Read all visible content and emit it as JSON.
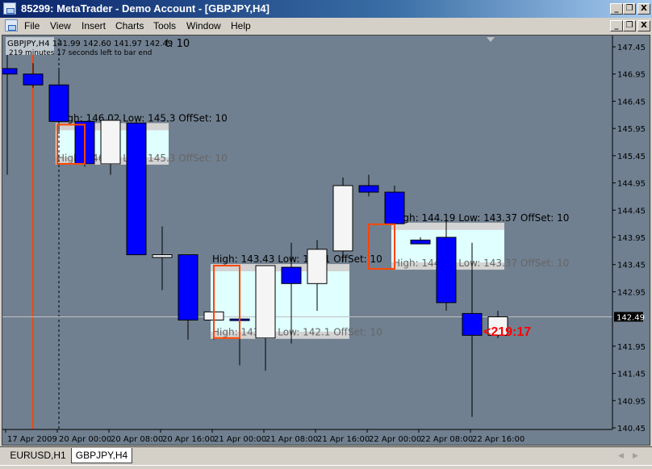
{
  "window": {
    "title": "85299: MetaTrader - Demo Account - [GBPJPY,H4]",
    "buttons": {
      "minimize": "_",
      "restore": "❐",
      "close": "X"
    }
  },
  "menu": {
    "items": [
      "File",
      "View",
      "Insert",
      "Charts",
      "Tools",
      "Window",
      "Help"
    ]
  },
  "chart": {
    "symbol": "GBPJPY,H4",
    "info_line": "GBPJPY,H4  141.99 142.60 141.97 142.49",
    "info_overlap": "t: 10",
    "timer_line": "219 minutes 17 seconds left to bar end",
    "countdown": "<219:17",
    "current_price": "142.49",
    "colors": {
      "background": "#708090",
      "bear_body": "#0000ff",
      "bull_body": "#f5f5f5",
      "box_fill": "#e0ffff",
      "box_border": "#ff4500",
      "label_band": "#d3d3d3",
      "countdown": "#ff0000",
      "vline": "#ff4500"
    },
    "price_axis": [
      "147.45",
      "146.95",
      "146.45",
      "145.95",
      "145.45",
      "144.95",
      "144.45",
      "143.95",
      "143.45",
      "142.95",
      "142.49",
      "141.95",
      "141.45",
      "140.95",
      "140.45"
    ],
    "time_axis": [
      "17 Apr 2009",
      "20 Apr 00:00",
      "20 Apr 08:00",
      "20 Apr 16:00",
      "21 Apr 00:00",
      "21 Apr 08:00",
      "21 Apr 16:00",
      "22 Apr 00:00",
      "22 Apr 08:00",
      "22 Apr 16:00"
    ],
    "candles": [
      {
        "o": 147.05,
        "h": 147.45,
        "l": 145.1,
        "c": 146.95
      },
      {
        "o": 146.95,
        "h": 147.15,
        "l": 146.7,
        "c": 146.75
      },
      {
        "o": 146.75,
        "h": 147.05,
        "l": 145.85,
        "c": 146.08
      },
      {
        "o": 146.08,
        "h": 146.08,
        "l": 145.25,
        "c": 145.3
      },
      {
        "o": 145.3,
        "h": 146.1,
        "l": 145.1,
        "c": 146.1
      },
      {
        "o": 146.05,
        "h": 146.1,
        "l": 143.63,
        "c": 143.63
      },
      {
        "o": 143.58,
        "h": 144.15,
        "l": 142.98,
        "c": 143.63
      },
      {
        "o": 143.63,
        "h": 143.63,
        "l": 142.07,
        "c": 142.43
      },
      {
        "o": 142.43,
        "h": 142.48,
        "l": 142.07,
        "c": 142.58
      },
      {
        "o": 142.45,
        "h": 142.45,
        "l": 141.6,
        "c": 142.43
      },
      {
        "o": 142.1,
        "h": 142.45,
        "l": 141.5,
        "c": 143.43
      },
      {
        "o": 143.4,
        "h": 143.85,
        "l": 142.0,
        "c": 143.1
      },
      {
        "o": 143.1,
        "h": 143.9,
        "l": 142.6,
        "c": 143.73
      },
      {
        "o": 143.7,
        "h": 145.05,
        "l": 143.5,
        "c": 144.9
      },
      {
        "o": 144.9,
        "h": 145.1,
        "l": 144.7,
        "c": 144.78
      },
      {
        "o": 144.78,
        "h": 144.9,
        "l": 143.9,
        "c": 144.2
      },
      {
        "o": 143.9,
        "h": 143.95,
        "l": 143.83,
        "c": 143.83
      },
      {
        "o": 143.95,
        "h": 144.35,
        "l": 142.6,
        "c": 142.75
      },
      {
        "o": 142.55,
        "h": 143.85,
        "l": 140.65,
        "c": 142.15
      },
      {
        "o": 142.15,
        "h": 142.6,
        "l": 142.1,
        "c": 142.49
      }
    ],
    "zones": [
      {
        "high": "146.02",
        "low": "145.3",
        "offset": "10",
        "high_val": 146.02,
        "low_val": 145.3,
        "from": 2,
        "to": 6
      },
      {
        "high": "143.43",
        "low": "142.1",
        "offset": "10",
        "high_val": 143.43,
        "low_val": 142.1,
        "from": 8,
        "to": 13
      },
      {
        "high": "144.19",
        "low": "143.37",
        "offset": "10",
        "high_val": 144.19,
        "low_val": 143.37,
        "from": 15,
        "to": 19
      }
    ],
    "label_template": {
      "high": "High: ",
      "low": "Low: ",
      "offset": "OffSet: "
    }
  },
  "tabs": [
    {
      "label": "EURUSD,H1",
      "active": false
    },
    {
      "label": "GBPJPY,H4",
      "active": true
    }
  ]
}
